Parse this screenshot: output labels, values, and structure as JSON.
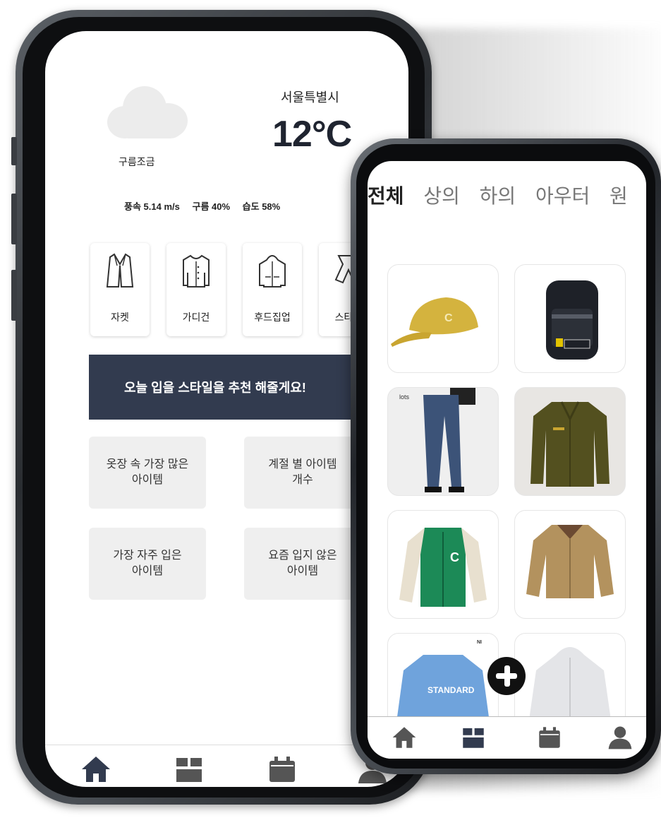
{
  "weather": {
    "city": "서울특별시",
    "temperature": "12°C",
    "condition": "구름조금",
    "stats": [
      "풍속 5.14 m/s",
      "구름 40%",
      "습도 58%"
    ]
  },
  "categories": [
    {
      "label": "자켓",
      "icon": "jacket-icon"
    },
    {
      "label": "가디건",
      "icon": "cardigan-icon"
    },
    {
      "label": "후드집업",
      "icon": "hoodie-zipup-icon"
    },
    {
      "label": "스타킹",
      "icon": "stocking-icon"
    }
  ],
  "banner": "오늘 입을 스타일을 추천 해줄게요!",
  "tiles": [
    {
      "line1": "옷장 속 가장 많은",
      "line2": "아이템"
    },
    {
      "line1": "계절 별 아이템",
      "line2": "개수"
    },
    {
      "line1": "가장 자주 입은",
      "line2": "아이템"
    },
    {
      "line1": "요즘 입지 않은",
      "line2": "아이템"
    }
  ],
  "closet_tabs": [
    "전체",
    "상의",
    "하의",
    "아우터",
    "원"
  ],
  "closet_items": [
    "yellow cap",
    "black backpack",
    "denim jeans",
    "olive field jacket",
    "green varsity jacket",
    "beige harrington jacket",
    "blue sweatshirt",
    "grey hoodie"
  ],
  "nav": [
    "home-icon",
    "closet-box-icon",
    "calendar-icon",
    "user-icon"
  ],
  "colors": {
    "banner": "#323b4f",
    "nav_active": "#323b4f",
    "nav_inactive": "#555555",
    "tile_bg": "#efefef"
  }
}
